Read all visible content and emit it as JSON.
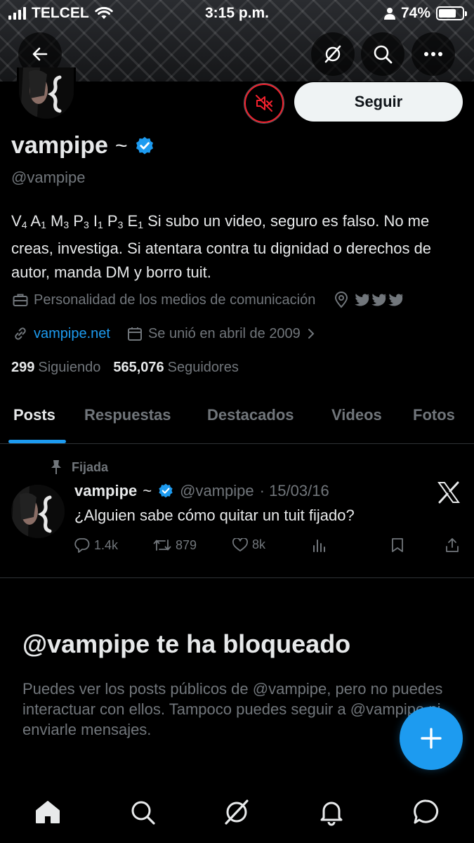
{
  "status_bar": {
    "carrier": "TELCEL",
    "time": "3:15 p.m.",
    "battery": "74%",
    "battery_level": 0.74
  },
  "top_nav": {
    "back_icon": "arrow-left-icon",
    "grok_icon": "grok-icon",
    "search_icon": "search-icon",
    "more_icon": "more-horizontal-icon"
  },
  "profile": {
    "display_name": "vampipe ᷈̈",
    "name_suffix": "~",
    "handle": "@vampipe",
    "follow_label": "Seguir",
    "bio_suffix": "Si subo un video, seguro es falso. No me creas, investiga. Si atentara contra tu dignidad o derechos de autor, manda DM y borro tuit.",
    "bio_letters": [
      {
        "l": "V",
        "n": "4"
      },
      {
        "l": "A",
        "n": "1"
      },
      {
        "l": "M",
        "n": "3"
      },
      {
        "l": "P",
        "n": "3"
      },
      {
        "l": "I",
        "n": "1"
      },
      {
        "l": "P",
        "n": "3"
      },
      {
        "l": "E",
        "n": "1"
      }
    ],
    "category": "Personalidad de los medios de comunicación",
    "website": "vampipe.net",
    "joined": "Se unió en abril de 2009",
    "following_count": "299",
    "following_label": "Siguiendo",
    "followers_count": "565,076",
    "followers_label": "Seguidores"
  },
  "tabs": [
    {
      "label": "Posts",
      "active": true
    },
    {
      "label": "Respuestas",
      "active": false
    },
    {
      "label": "Destacados",
      "active": false
    },
    {
      "label": "Videos",
      "active": false
    },
    {
      "label": "Fotos",
      "active": false
    }
  ],
  "pinned_tweet": {
    "pinned_label": "Fijada",
    "author_name": "vampipe",
    "author_handle": "@vampipe",
    "date": "· 15/03/16",
    "text": "¿Alguien sabe cómo quitar un tuit fijado?",
    "replies": "1.4k",
    "retweets": "879",
    "likes": "8k"
  },
  "blocked": {
    "title": "@vampipe te ha bloqueado",
    "message": "Puedes ver los posts públicos de @vampipe, pero no puedes interactuar con ellos. Tampoco puedes seguir a @vampipe ni enviarle mensajes."
  },
  "bottom_nav": [
    "home-icon",
    "search-icon",
    "grok-icon",
    "bell-icon",
    "messages-icon"
  ],
  "colors": {
    "accent": "#1d9bf0",
    "text_primary": "#e7e9ea",
    "text_secondary": "#71767b",
    "mute_red": "#f4212e"
  }
}
